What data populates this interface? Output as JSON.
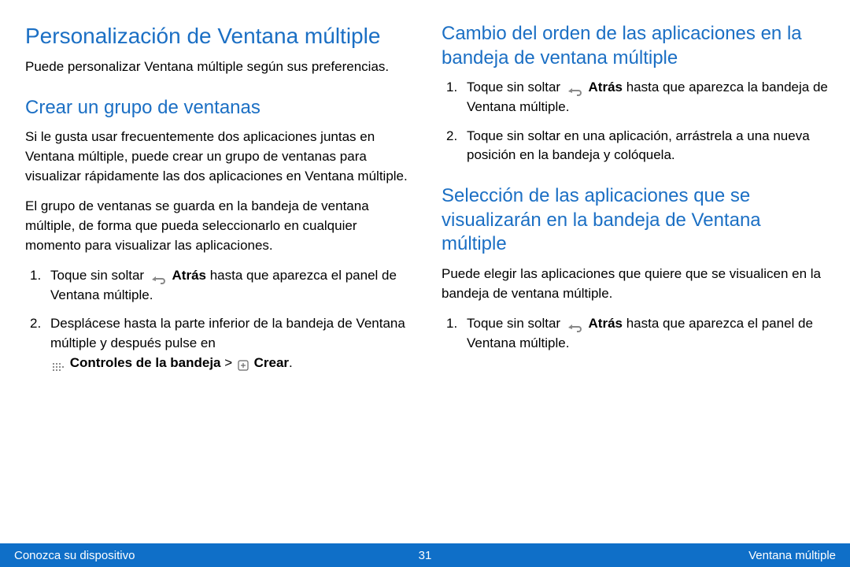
{
  "left": {
    "main_title": "Personalización de Ventana múltiple",
    "intro": "Puede personalizar Ventana múltiple según sus preferencias.",
    "sub_title": "Crear un grupo de ventanas",
    "para1": "Si le gusta usar frecuentemente dos aplicaciones juntas en Ventana múltiple, puede crear un grupo de ventanas para visualizar rápidamente las dos aplicaciones en Ventana múltiple.",
    "para2": "El grupo de ventanas se guarda en la bandeja de ventana múltiple, de forma que pueda seleccionarlo en cualquier momento para visualizar las aplicaciones.",
    "step1_a": "Toque sin soltar ",
    "step1_back": "Atrás",
    "step1_b": " hasta que aparezca el panel de Ventana múltiple.",
    "step2_a": "Desplácese hasta la parte inferior de la bandeja de Ventana múltiple y después pulse en",
    "step2_bold1": "Controles de la bandeja",
    "step2_gt": " > ",
    "step2_bold2": "Crear",
    "step2_dot": "."
  },
  "right": {
    "sub1_title": "Cambio del orden de las aplicaciones en la bandeja de ventana múltiple",
    "sub1_step1_a": "Toque sin soltar ",
    "sub1_step1_back": "Atrás",
    "sub1_step1_b": " hasta que aparezca la bandeja de Ventana múltiple.",
    "sub1_step2": "Toque sin soltar en una aplicación, arrástrela a una nueva posición en la bandeja y colóquela.",
    "sub2_title": "Selección de las aplicaciones que se visualizarán en la bandeja de Ventana múltiple",
    "sub2_para": "Puede elegir las aplicaciones que quiere que se visualicen en la bandeja de ventana múltiple.",
    "sub2_step1_a": "Toque sin soltar ",
    "sub2_step1_back": "Atrás",
    "sub2_step1_b": " hasta que aparezca el panel de Ventana múltiple."
  },
  "footer": {
    "left": "Conozca su dispositivo",
    "center": "31",
    "right": "Ventana múltiple"
  }
}
